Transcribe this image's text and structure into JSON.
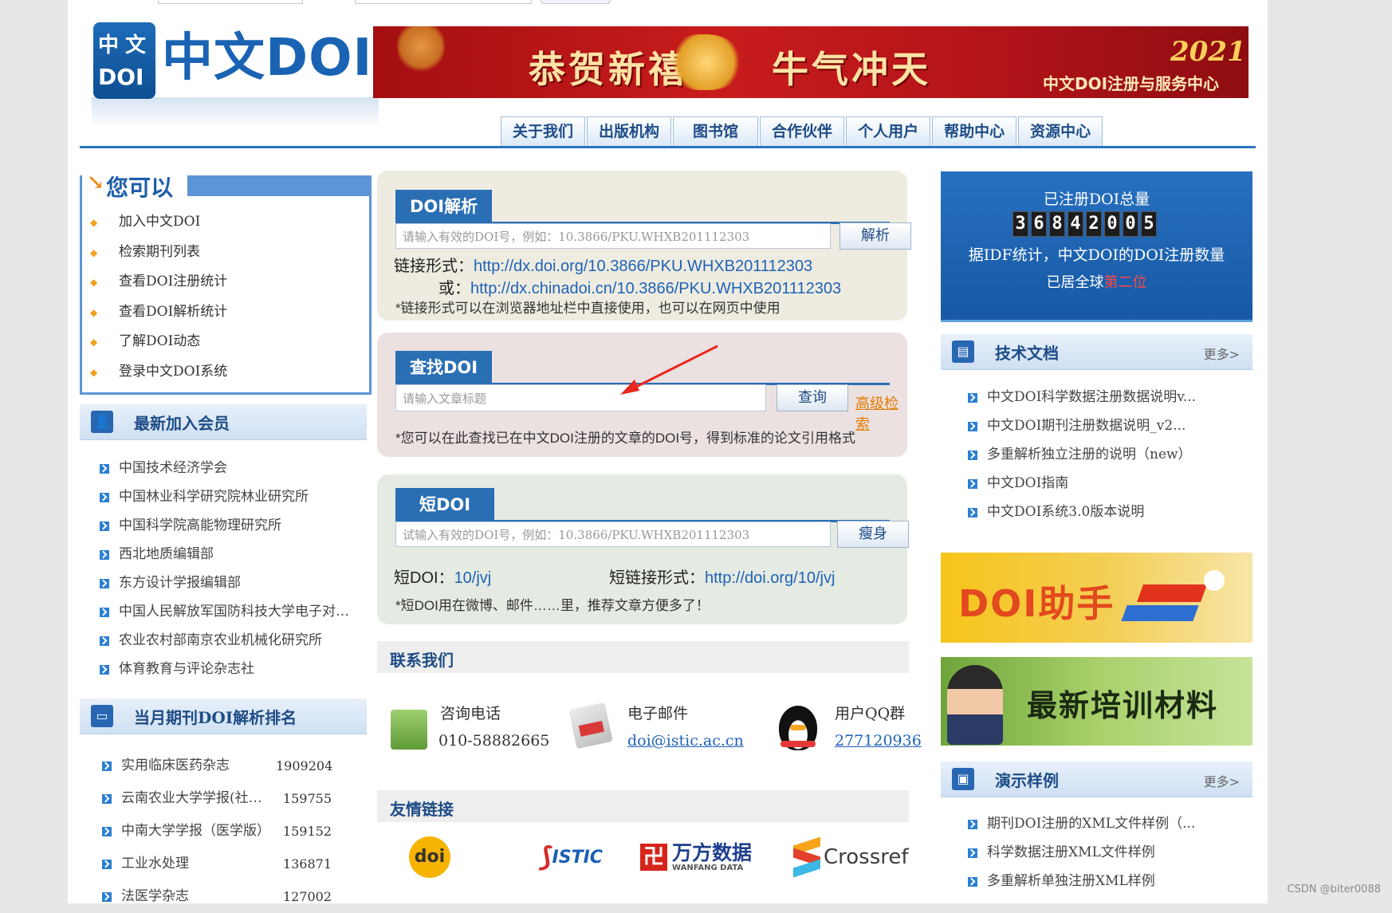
{
  "logo": {
    "text": "中文DOI",
    "mark": "中文DOI"
  },
  "banner": {
    "phrase1": "恭贺新禧",
    "phrase2": "牛气冲天",
    "year": "2021",
    "org": "中文DOI注册与服务中心"
  },
  "nav": [
    "关于我们",
    "出版机构",
    "图书馆",
    "合作伙伴",
    "个人用户",
    "帮助中心",
    "资源中心"
  ],
  "you_can": {
    "title": "您可以",
    "items": [
      "加入中文DOI",
      "检索期刊列表",
      "查看DOI注册统计",
      "查看DOI解析统计",
      "了解DOI动态",
      "登录中文DOI系统"
    ]
  },
  "new_members": {
    "title": "最新加入会员",
    "items": [
      "中国技术经济学会",
      "中国林业科学研究院林业研究所",
      "中国科学院高能物理研究所",
      "西北地质编辑部",
      "东方设计学报编辑部",
      "中国人民解放军国防科技大学电子对…",
      "农业农村部南京农业机械化研究所",
      "体育教育与评论杂志社"
    ]
  },
  "ranking": {
    "title": "当月期刊DOI解析排名",
    "rows": [
      {
        "name": "实用临床医药杂志",
        "count": "1909204"
      },
      {
        "name": "云南农业大学学报(社…",
        "count": "159755"
      },
      {
        "name": "中南大学学报（医学版）",
        "count": "159152"
      },
      {
        "name": "工业水处理",
        "count": "136871"
      },
      {
        "name": "法医学杂志",
        "count": "127002"
      }
    ]
  },
  "resolve": {
    "tab": "DOI解析",
    "placeholder": "请输入有效的DOI号，例如：10.3866/PKU.WHXB201112303",
    "button": "解析",
    "link_label": "链接形式：",
    "link1": "http://dx.doi.org/10.3866/PKU.WHXB201112303",
    "or_label": "或：",
    "link2": "http://dx.chinadoi.cn/10.3866/PKU.WHXB201112303",
    "note": "*链接形式可以在浏览器地址栏中直接使用，也可以在网页中使用"
  },
  "find": {
    "tab": "查找DOI",
    "placeholder": "请输入文章标题",
    "button": "查询",
    "advanced": "高级检索",
    "note": "*您可以在此查找已在中文DOI注册的文章的DOI号，得到标准的论文引用格式"
  },
  "short": {
    "tab": "短DOI",
    "placeholder": "试输入有效的DOI号，例如：10.3866/PKU.WHXB201112303",
    "button": "瘦身",
    "short_label": "短DOI：",
    "short_value": "10/jvj",
    "short_link_label": "短链接形式：",
    "short_link_value": "http://doi.org/10/jvj",
    "note": "*短DOI用在微博、邮件……里，推荐文章方便多了！"
  },
  "contact": {
    "title": "联系我们",
    "phone_label": "咨询电话",
    "phone": "010-58882665",
    "email_label": "电子邮件",
    "email": "doi@istic.ac.cn",
    "qq_label": "用户QQ群",
    "qq": "277120936"
  },
  "links": {
    "title": "友情链接",
    "partners": [
      "doi",
      "ISTIC",
      "万方数据",
      "WANFANG DATA",
      "Crossref"
    ]
  },
  "doi_total": {
    "title": "已注册DOI总量",
    "digits": [
      "3",
      "6",
      "8",
      "4",
      "2",
      "0",
      "0",
      "5"
    ],
    "desc": "据IDF统计，中文DOI的DOI注册数量",
    "rank_prefix": "已居全球",
    "rank_value": "第二位"
  },
  "tech_docs": {
    "title": "技术文档",
    "more": "更多>",
    "items": [
      "中文DOI科学数据注册数据说明v...",
      "中文DOI期刊注册数据说明_v2...",
      "多重解析独立注册的说明（new）",
      "中文DOI指南",
      "中文DOI系统3.0版本说明"
    ]
  },
  "ads": {
    "helper": "DOI助手",
    "training": "最新培训材料"
  },
  "demos": {
    "title": "演示样例",
    "more": "更多>",
    "items": [
      "期刊DOI注册的XML文件样例（...",
      "科学数据注册XML文件样例",
      "多重解析单独注册XML样例"
    ]
  },
  "watermark": "CSDN @biter0088",
  "colors": {
    "brand_blue": "#2a6eb4",
    "link_blue": "#1f62b8",
    "highlight_red": "#ff4747",
    "advanced_orange": "#e07b00"
  }
}
